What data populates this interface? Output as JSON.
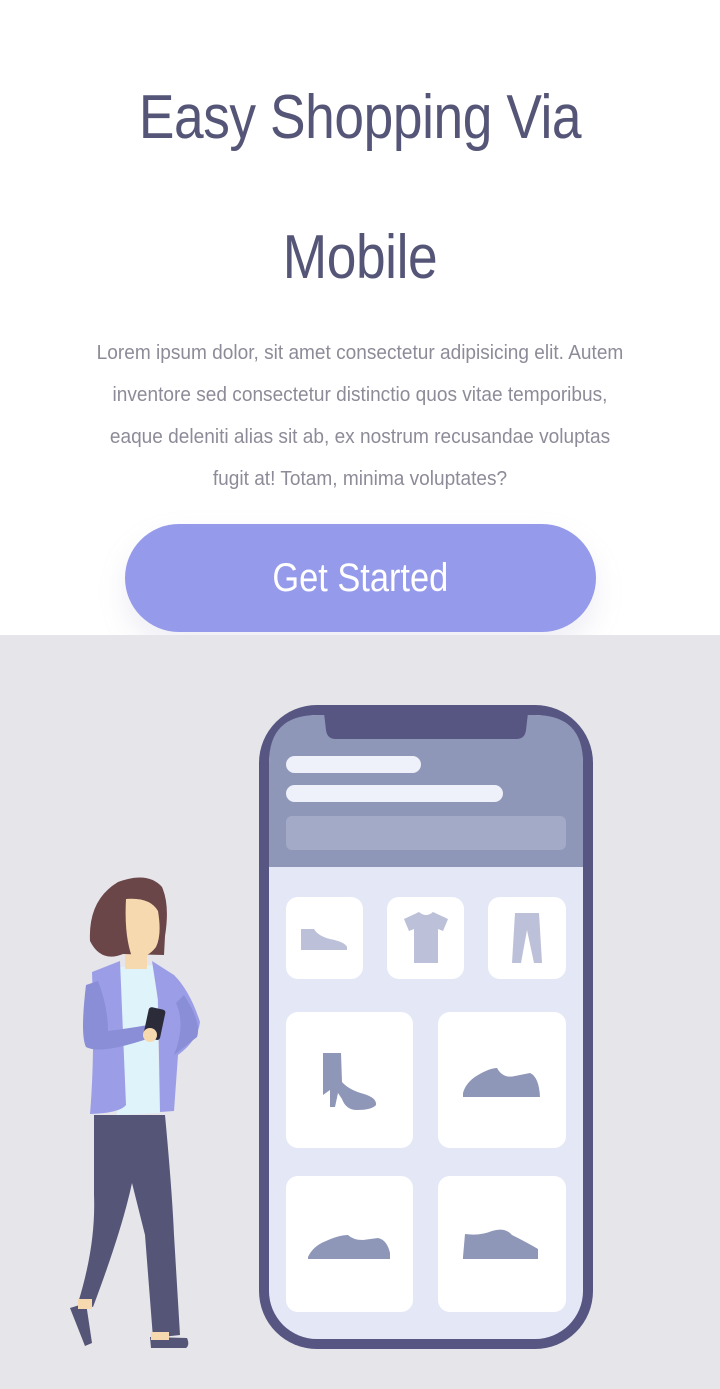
{
  "hero": {
    "title_line1": "Easy Shopping Via",
    "title_line2": "Mobile",
    "description": "Lorem ipsum dolor, sit amet consectetur adipisicing elit. Autem inventore sed consectetur distinctio quos vitae temporibus, eaque deleniti alias sit ab, ex nostrum recusandae voluptas fugit at! Totam, minima voluptates?",
    "cta_label": "Get Started"
  },
  "illustration": {
    "subject": "woman-holding-phone",
    "phone_products": [
      "shoe-icon",
      "tshirt-icon",
      "pants-icon",
      "boot-icon",
      "sneaker-icon",
      "sneaker-icon",
      "sneaker-icon"
    ],
    "colors": {
      "accent": "#959aeb",
      "title": "#555577",
      "text": "#8e8b98",
      "phone_frame": "#575682",
      "phone_header": "#8f97b8",
      "section_bg": "#e5e5ea",
      "product_icon": "#8f97b8",
      "product_icon_light": "#bcc0d8"
    }
  }
}
